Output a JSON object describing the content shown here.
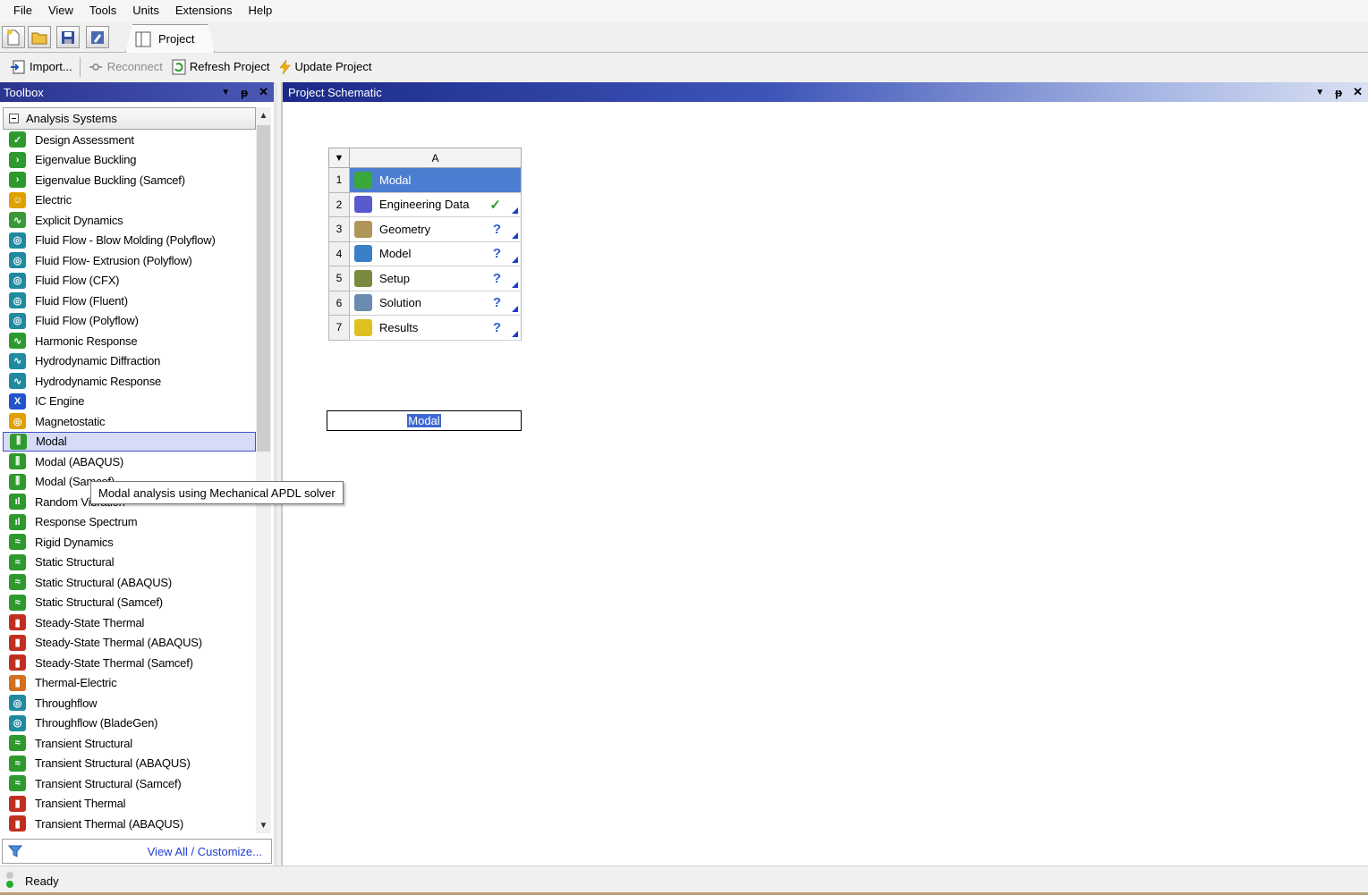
{
  "menu": [
    "File",
    "View",
    "Tools",
    "Units",
    "Extensions",
    "Help"
  ],
  "tabs": {
    "project": "Project"
  },
  "toolbar": {
    "import": "Import...",
    "reconnect": "Reconnect",
    "refresh": "Refresh Project",
    "update": "Update Project"
  },
  "toolbox": {
    "title": "Toolbox",
    "group": "Analysis Systems",
    "items": [
      {
        "label": "Design Assessment",
        "color": "#2e9a2e",
        "glyph": "✓"
      },
      {
        "label": "Eigenvalue Buckling",
        "color": "#2e9a2e",
        "glyph": "›"
      },
      {
        "label": "Eigenvalue Buckling (Samcef)",
        "color": "#2e9a2e",
        "glyph": "›"
      },
      {
        "label": "Electric",
        "color": "#e0a000",
        "glyph": "☺"
      },
      {
        "label": "Explicit Dynamics",
        "color": "#3a9a3a",
        "glyph": "∿"
      },
      {
        "label": "Fluid Flow - Blow Molding (Polyflow)",
        "color": "#1f8aa0",
        "glyph": "◎"
      },
      {
        "label": "Fluid Flow- Extrusion (Polyflow)",
        "color": "#1f8aa0",
        "glyph": "◎"
      },
      {
        "label": "Fluid Flow (CFX)",
        "color": "#1f8aa0",
        "glyph": "◎"
      },
      {
        "label": "Fluid Flow (Fluent)",
        "color": "#1f8aa0",
        "glyph": "◎"
      },
      {
        "label": "Fluid Flow (Polyflow)",
        "color": "#1f8aa0",
        "glyph": "◎"
      },
      {
        "label": "Harmonic Response",
        "color": "#2e9a2e",
        "glyph": "∿"
      },
      {
        "label": "Hydrodynamic Diffraction",
        "color": "#1f8aa0",
        "glyph": "∿"
      },
      {
        "label": "Hydrodynamic Response",
        "color": "#1f8aa0",
        "glyph": "∿"
      },
      {
        "label": "IC Engine",
        "color": "#2255cc",
        "glyph": "X"
      },
      {
        "label": "Magnetostatic",
        "color": "#e0a000",
        "glyph": "◎"
      },
      {
        "label": "Modal",
        "color": "#2e9a2e",
        "glyph": "⫼"
      },
      {
        "label": "Modal (ABAQUS)",
        "color": "#2e9a2e",
        "glyph": "⫼"
      },
      {
        "label": "Modal (Samcef)",
        "color": "#2e9a2e",
        "glyph": "⫼"
      },
      {
        "label": "Random Vibration",
        "color": "#2e9a2e",
        "glyph": "ıl"
      },
      {
        "label": "Response Spectrum",
        "color": "#2e9a2e",
        "glyph": "ıl"
      },
      {
        "label": "Rigid Dynamics",
        "color": "#2e9a2e",
        "glyph": "≈"
      },
      {
        "label": "Static Structural",
        "color": "#2e9a2e",
        "glyph": "≈"
      },
      {
        "label": "Static Structural (ABAQUS)",
        "color": "#2e9a2e",
        "glyph": "≈"
      },
      {
        "label": "Static Structural (Samcef)",
        "color": "#2e9a2e",
        "glyph": "≈"
      },
      {
        "label": "Steady-State Thermal",
        "color": "#c03020",
        "glyph": "▮"
      },
      {
        "label": "Steady-State Thermal (ABAQUS)",
        "color": "#c03020",
        "glyph": "▮"
      },
      {
        "label": "Steady-State Thermal (Samcef)",
        "color": "#c03020",
        "glyph": "▮"
      },
      {
        "label": "Thermal-Electric",
        "color": "#d07020",
        "glyph": "▮"
      },
      {
        "label": "Throughflow",
        "color": "#1f8aa0",
        "glyph": "◎"
      },
      {
        "label": "Throughflow (BladeGen)",
        "color": "#1f8aa0",
        "glyph": "◎"
      },
      {
        "label": "Transient Structural",
        "color": "#2e9a2e",
        "glyph": "≈"
      },
      {
        "label": "Transient Structural (ABAQUS)",
        "color": "#2e9a2e",
        "glyph": "≈"
      },
      {
        "label": "Transient Structural (Samcef)",
        "color": "#2e9a2e",
        "glyph": "≈"
      },
      {
        "label": "Transient Thermal",
        "color": "#c03020",
        "glyph": "▮"
      },
      {
        "label": "Transient Thermal (ABAQUS)",
        "color": "#c03020",
        "glyph": "▮"
      }
    ],
    "selected_index": 15,
    "footer_link": "View All / Customize..."
  },
  "tooltip": "Modal analysis using Mechanical APDL solver",
  "schematic": {
    "title": "Project Schematic",
    "system": {
      "column": "A",
      "name": "Modal",
      "rows": [
        {
          "num": "1",
          "label": "Modal",
          "status": "",
          "color": "#3aa83a"
        },
        {
          "num": "2",
          "label": "Engineering Data",
          "status": "✓",
          "color": "#5a5ad0"
        },
        {
          "num": "3",
          "label": "Geometry",
          "status": "?",
          "color": "#b0955a"
        },
        {
          "num": "4",
          "label": "Model",
          "status": "?",
          "color": "#3a7fc8"
        },
        {
          "num": "5",
          "label": "Setup",
          "status": "?",
          "color": "#7a8a40"
        },
        {
          "num": "6",
          "label": "Solution",
          "status": "?",
          "color": "#6a8ab0"
        },
        {
          "num": "7",
          "label": "Results",
          "status": "?",
          "color": "#e0c020"
        }
      ]
    }
  },
  "status": {
    "text": "Ready"
  }
}
